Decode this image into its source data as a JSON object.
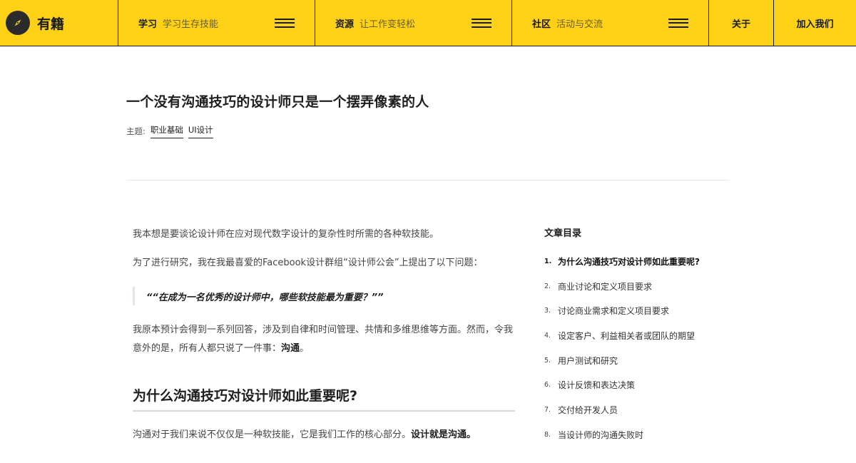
{
  "brand": {
    "name": "有籍",
    "logo_icon": "compass-icon"
  },
  "nav": {
    "groups": [
      {
        "title": "学习",
        "subtitle": "学习生存技能"
      },
      {
        "title": "资源",
        "subtitle": "让工作变轻松"
      },
      {
        "title": "社区",
        "subtitle": "活动与交流"
      }
    ],
    "about": "关于",
    "join": "加入我们"
  },
  "article": {
    "title": "一个没有沟通技巧的设计师只是一个摆弄像素的人",
    "topics_label": "主题:",
    "topics": [
      "职业基础",
      "UI设计"
    ],
    "p1": "我本想是要谈论设计师在应对现代数字设计的复杂性时所需的各种软技能。",
    "p2": "为了进行研究，我在我最喜爱的Facebook设计群组“设计师公会”上提出了以下问题：",
    "quote": "““在成为一名优秀的设计师中，哪些软技能最为重要？””",
    "p3_text": "我原本预计会得到一系列回答，涉及到自律和时间管理、共情和多维思维等方面。然而，令我意外的是，所有人都只说了一件事：",
    "p3_strong": "沟通",
    "p3_end": "。",
    "heading": "为什么沟通技巧对设计师如此重要呢?",
    "p4_text": "沟通对于我们来说不仅仅是一种软技能，它是我们工作的核心部分。",
    "p4_strong": "设计就是沟通。"
  },
  "toc": {
    "title": "文章目录",
    "items": [
      {
        "num": "1.",
        "label": "为什么沟通技巧对设计师如此重要呢?"
      },
      {
        "num": "2.",
        "label": "商业讨论和定义项目要求"
      },
      {
        "num": "3.",
        "label": "讨论商业需求和定义项目要求"
      },
      {
        "num": "4.",
        "label": "设定客户、利益相关者或团队的期望"
      },
      {
        "num": "5.",
        "label": "用户测试和研究"
      },
      {
        "num": "6.",
        "label": "设计反馈和表达决策"
      },
      {
        "num": "7.",
        "label": "交付给开发人员"
      },
      {
        "num": "8.",
        "label": "当设计师的沟通失败时"
      }
    ]
  },
  "colors": {
    "accent": "#fcd116",
    "text": "#1e1e1e",
    "muted": "#444444"
  }
}
